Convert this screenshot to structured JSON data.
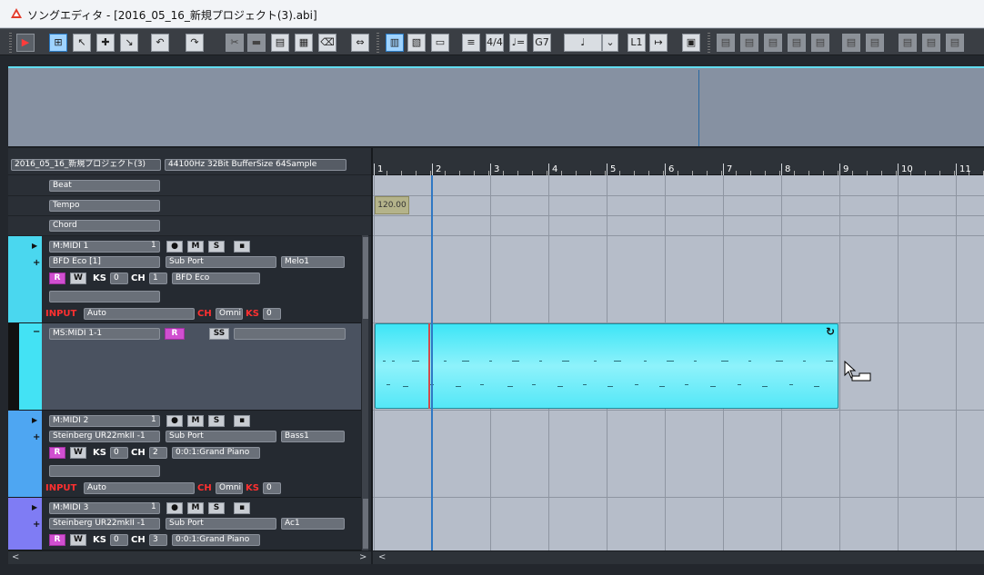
{
  "window": {
    "title": "ソングエディタ - [2016_05_16_新規プロジェクト(3).abi]"
  },
  "toolbar": {
    "time_sig_label": "4/4",
    "tempo_label": "♩=",
    "chord_label": "G7",
    "note_value": "♩",
    "locator_label": "L1"
  },
  "project": {
    "name": "2016_05_16_新規プロジェクト(3)",
    "format": "44100Hz 32Bit BufferSize 64Sample"
  },
  "global_tracks": [
    {
      "label": "Beat"
    },
    {
      "label": "Tempo"
    },
    {
      "label": "Chord"
    }
  ],
  "tracks": [
    {
      "name": "M:MIDI 1",
      "number": "1",
      "instrument": "BFD Eco [1]",
      "port": "Sub Port",
      "program": "Melo1",
      "ks": "0",
      "ch": "1",
      "channel_name": "BFD Eco",
      "input_label": "INPUT",
      "input": "Auto",
      "ch_label": "CH",
      "ch_value": "Omni",
      "ks_label": "KS",
      "ks_value": "0",
      "color": "#4ad7ef"
    },
    {
      "name": "MS:MIDI 1-1",
      "r": "R",
      "ss": "SS",
      "color": "#43e2f4"
    },
    {
      "name": "M:MIDI 2",
      "number": "1",
      "instrument": "Steinberg UR22mkII -1",
      "port": "Sub Port",
      "program": "Bass1",
      "ks": "0",
      "ch": "2",
      "channel_name": "0:0:1:Grand Piano",
      "input_label": "INPUT",
      "input": "Auto",
      "ch_label": "CH",
      "ch_value": "Omni",
      "ks_label": "KS",
      "ks_value": "0",
      "color": "#4ea6f2"
    },
    {
      "name": "M:MIDI 3",
      "number": "1",
      "instrument": "Steinberg UR22mkII -1",
      "port": "Sub Port",
      "program": "Ac1",
      "ks": "0",
      "ch": "3",
      "channel_name": "0:0:1:Grand Piano",
      "color": "#7f7cf4"
    }
  ],
  "buttons": {
    "m": "M",
    "s": "S",
    "r": "R",
    "w": "W",
    "ks": "KS",
    "ch": "CH"
  },
  "ruler": [
    "1",
    "2",
    "3",
    "4",
    "5",
    "6",
    "7",
    "8",
    "9",
    "10",
    "11"
  ],
  "tempo_value": "120.00",
  "icons": [
    "app-logo-icon",
    "play-icon",
    "select-icon",
    "pointer-icon",
    "undo-icon",
    "redo-icon",
    "metronome-icon",
    "record-icon",
    "loop-icon",
    "cursor-icon"
  ]
}
